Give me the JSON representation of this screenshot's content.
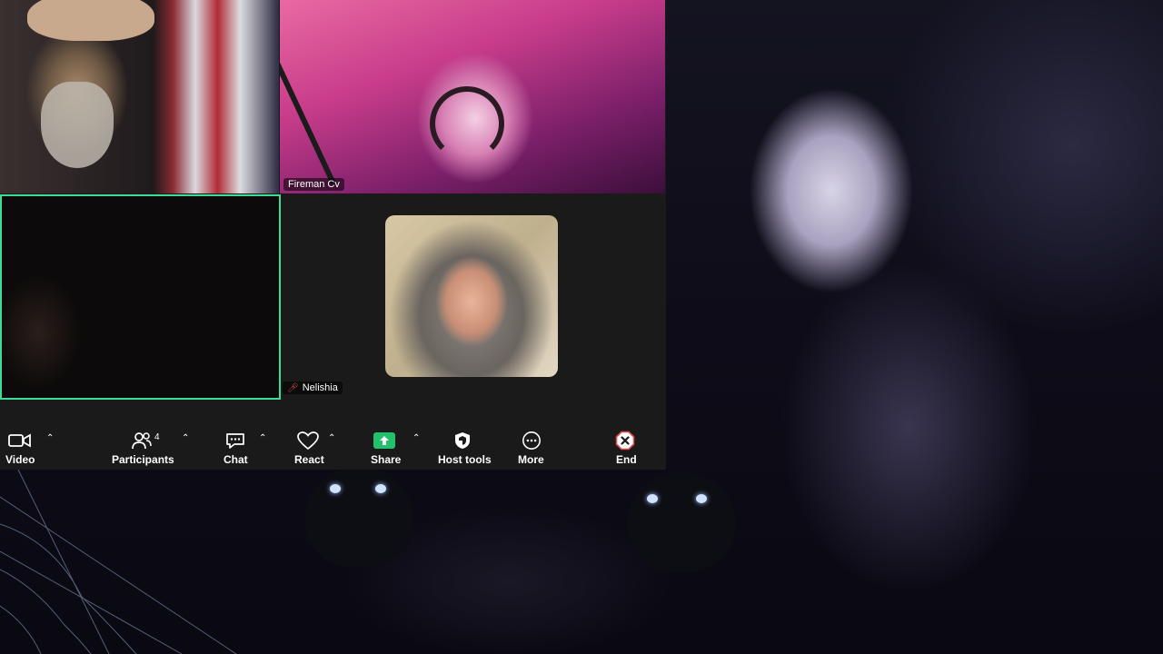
{
  "window": {
    "participants_tiles": [
      {
        "name": ""
      },
      {
        "name": "Fireman Cv"
      },
      {
        "name": ""
      },
      {
        "name": "Nelishia"
      }
    ]
  },
  "toolbar": {
    "video_label": "Video",
    "participants_label": "Participants",
    "participants_count": "4",
    "chat_label": "Chat",
    "react_label": "React",
    "share_label": "Share",
    "host_tools_label": "Host tools",
    "more_label": "More",
    "end_label": "End"
  },
  "icons": [
    "video-icon",
    "participants-icon",
    "chat-icon",
    "react-icon",
    "share-icon",
    "host-tools-icon",
    "more-icon",
    "end-icon",
    "muted-mic-icon",
    "caret-up-icon"
  ],
  "colors": {
    "active_speaker_border": "#3ddc97",
    "share_green": "#23c16b",
    "end_red": "#e5484d",
    "toolbar_bg": "#1a1a1a"
  }
}
